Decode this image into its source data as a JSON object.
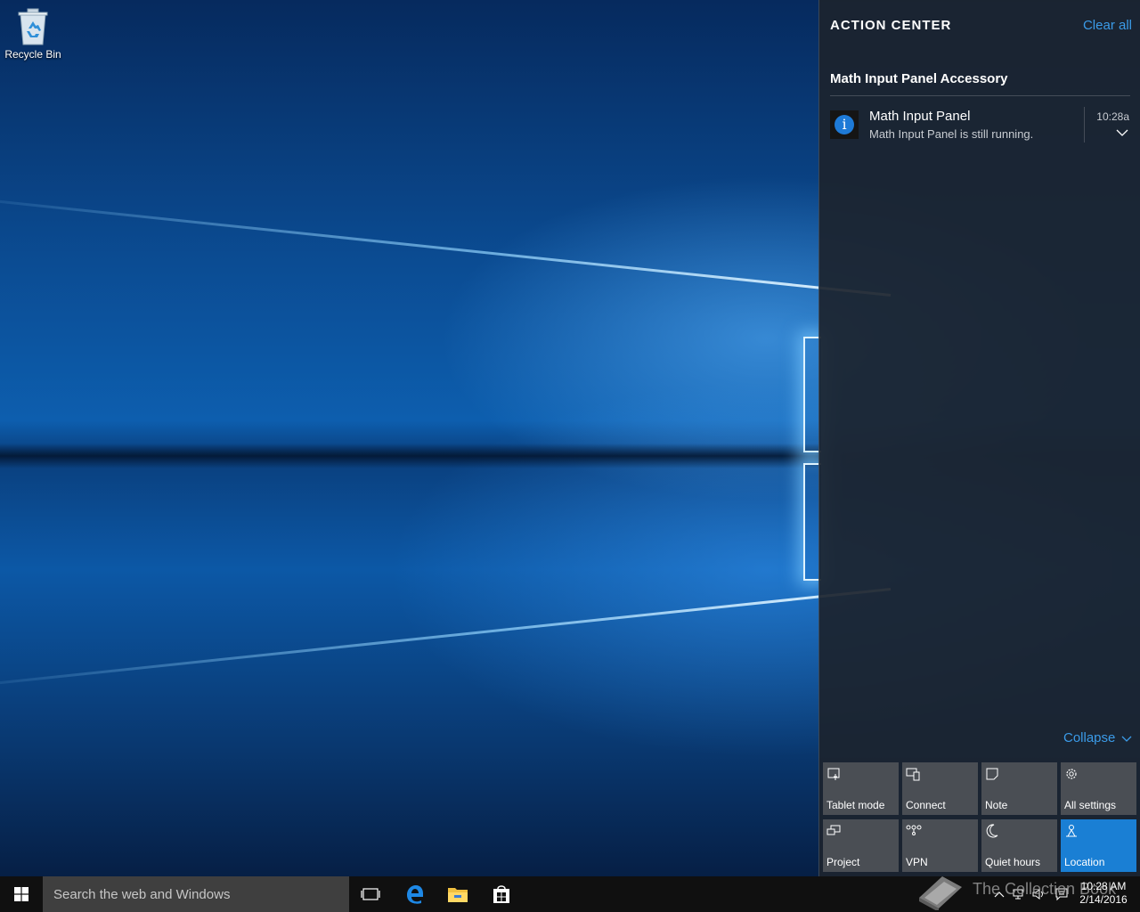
{
  "desktop": {
    "icons": [
      {
        "label": "Recycle Bin",
        "icon": "recycle-bin-icon"
      }
    ]
  },
  "action_center": {
    "title": "ACTION CENTER",
    "clear_all": "Clear all",
    "group": {
      "title": "Math Input Panel Accessory",
      "notification": {
        "title": "Math Input Panel",
        "body": "Math Input Panel is still running.",
        "time": "10:28a",
        "icon": "info-icon"
      }
    },
    "collapse": "Collapse",
    "quick_actions": [
      {
        "label": "Tablet mode",
        "icon": "tablet-mode-icon",
        "active": false
      },
      {
        "label": "Connect",
        "icon": "connect-icon",
        "active": false
      },
      {
        "label": "Note",
        "icon": "note-icon",
        "active": false
      },
      {
        "label": "All settings",
        "icon": "gear-icon",
        "active": false
      },
      {
        "label": "Project",
        "icon": "project-icon",
        "active": false
      },
      {
        "label": "VPN",
        "icon": "vpn-icon",
        "active": false
      },
      {
        "label": "Quiet hours",
        "icon": "moon-icon",
        "active": false
      },
      {
        "label": "Location",
        "icon": "location-icon",
        "active": true
      }
    ],
    "accent_color": "#1a7fd4"
  },
  "taskbar": {
    "search_placeholder": "Search the web and Windows",
    "pinned": [
      {
        "icon": "task-view-icon"
      },
      {
        "icon": "edge-icon"
      },
      {
        "icon": "file-explorer-icon"
      },
      {
        "icon": "store-icon"
      }
    ],
    "clock": {
      "time": "10:28 AM",
      "date": "2/14/2016"
    }
  },
  "watermark": {
    "text": "The Collection Book"
  }
}
